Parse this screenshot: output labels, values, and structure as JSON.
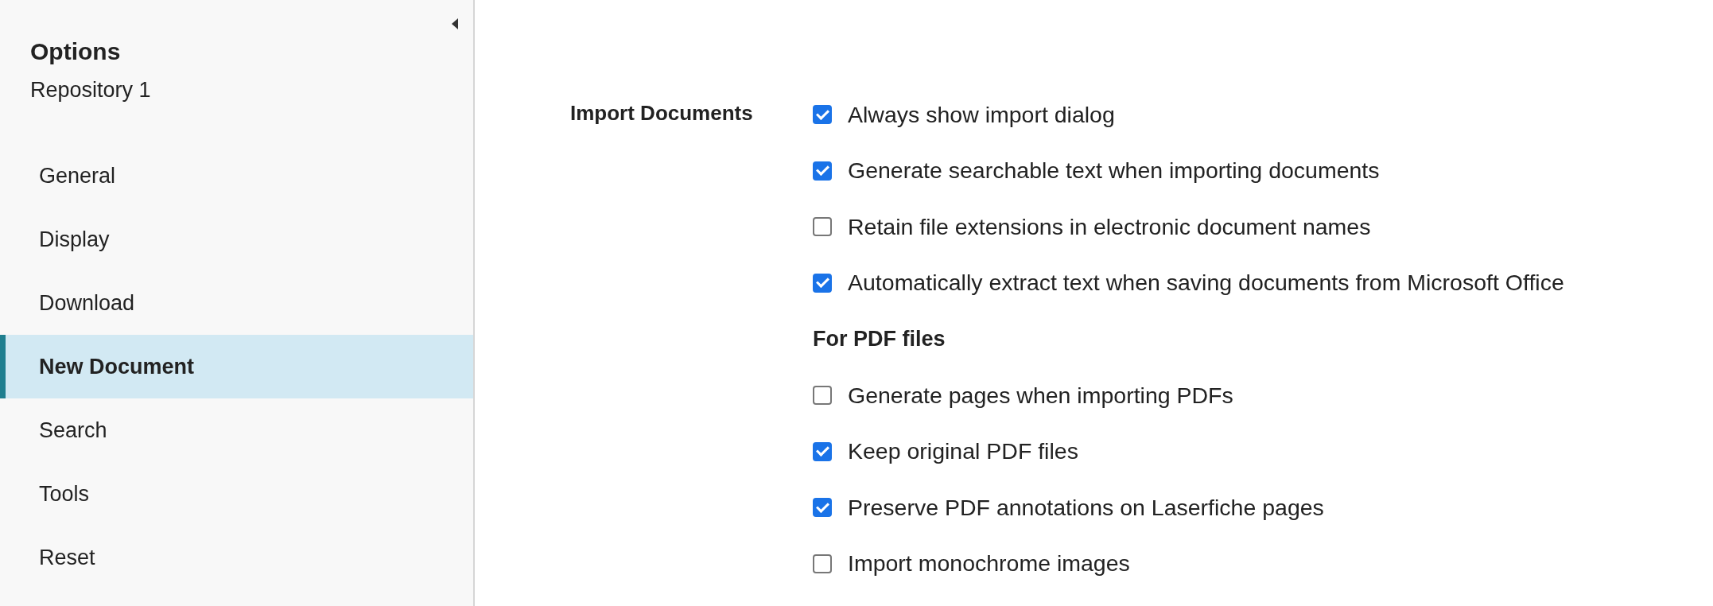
{
  "sidebar": {
    "title": "Options",
    "subtitle": "Repository 1",
    "items": [
      {
        "label": "General",
        "selected": false
      },
      {
        "label": "Display",
        "selected": false
      },
      {
        "label": "Download",
        "selected": false
      },
      {
        "label": "New Document",
        "selected": true
      },
      {
        "label": "Search",
        "selected": false
      },
      {
        "label": "Tools",
        "selected": false
      },
      {
        "label": "Reset",
        "selected": false
      }
    ]
  },
  "section": {
    "label": "Import Documents",
    "options": [
      {
        "kind": "checkbox",
        "label": "Always show import dialog",
        "checked": true
      },
      {
        "kind": "checkbox",
        "label": "Generate searchable text when importing documents",
        "checked": true
      },
      {
        "kind": "checkbox",
        "label": "Retain file extensions in electronic document names",
        "checked": false
      },
      {
        "kind": "checkbox",
        "label": "Automatically extract text when saving documents from Microsoft Office",
        "checked": true
      },
      {
        "kind": "heading",
        "label": "For PDF files"
      },
      {
        "kind": "checkbox",
        "label": "Generate pages when importing PDFs",
        "checked": false
      },
      {
        "kind": "checkbox",
        "label": "Keep original PDF files",
        "checked": true
      },
      {
        "kind": "checkbox",
        "label": "Preserve PDF annotations on Laserfiche pages",
        "checked": true
      },
      {
        "kind": "checkbox",
        "label": "Import monochrome images",
        "checked": false
      }
    ]
  }
}
